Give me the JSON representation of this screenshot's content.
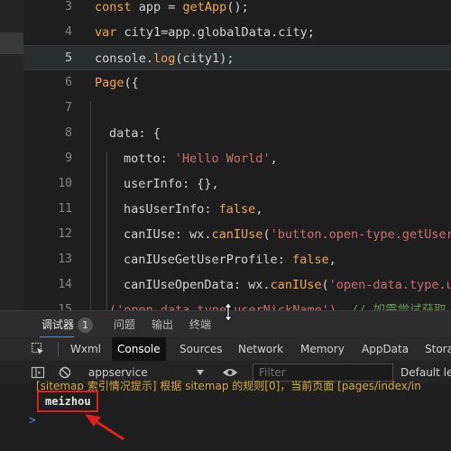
{
  "editor": {
    "lines": [
      {
        "num": "3",
        "tokens": [
          {
            "c": "kw",
            "t": "const"
          },
          {
            "c": "plain",
            "t": " app = "
          },
          {
            "c": "fn",
            "t": "getApp"
          },
          {
            "c": "plain",
            "t": "();"
          }
        ]
      },
      {
        "num": "4",
        "tokens": [
          {
            "c": "kw",
            "t": "var"
          },
          {
            "c": "plain",
            "t": " city1=app.globalData.city;"
          }
        ]
      },
      {
        "num": "5",
        "tokens": [
          {
            "c": "plain",
            "t": "console."
          },
          {
            "c": "fn",
            "t": "log"
          },
          {
            "c": "plain",
            "t": "(city1);"
          }
        ]
      },
      {
        "num": "6",
        "tokens": [
          {
            "c": "fn",
            "t": "Page"
          },
          {
            "c": "plain",
            "t": "({"
          }
        ]
      },
      {
        "num": "7",
        "tokens": []
      },
      {
        "num": "8",
        "tokens": [
          {
            "c": "prop",
            "t": "data"
          },
          {
            "c": "plain",
            "t": ": {"
          }
        ]
      },
      {
        "num": "9",
        "tokens": [
          {
            "c": "prop",
            "t": "motto"
          },
          {
            "c": "plain",
            "t": ": "
          },
          {
            "c": "str",
            "t": "'Hello World'"
          },
          {
            "c": "plain",
            "t": ","
          }
        ]
      },
      {
        "num": "10",
        "tokens": [
          {
            "c": "prop",
            "t": "userInfo"
          },
          {
            "c": "plain",
            "t": ": {},"
          }
        ]
      },
      {
        "num": "11",
        "tokens": [
          {
            "c": "prop",
            "t": "hasUserInfo"
          },
          {
            "c": "plain",
            "t": ": "
          },
          {
            "c": "lit",
            "t": "false"
          },
          {
            "c": "plain",
            "t": ","
          }
        ]
      },
      {
        "num": "12",
        "tokens": [
          {
            "c": "prop",
            "t": "canIUse"
          },
          {
            "c": "plain",
            "t": ": wx."
          },
          {
            "c": "fn",
            "t": "canIUse"
          },
          {
            "c": "plain",
            "t": "("
          },
          {
            "c": "str",
            "t": "'button.open-type.getUserI"
          }
        ]
      },
      {
        "num": "13",
        "tokens": [
          {
            "c": "prop",
            "t": "canIUseGetUserProfile"
          },
          {
            "c": "plain",
            "t": ": "
          },
          {
            "c": "lit",
            "t": "false"
          },
          {
            "c": "plain",
            "t": ","
          }
        ]
      },
      {
        "num": "14",
        "tokens": [
          {
            "c": "prop",
            "t": "canIUseOpenData"
          },
          {
            "c": "plain",
            "t": ": wx."
          },
          {
            "c": "fn",
            "t": "canIUse"
          },
          {
            "c": "plain",
            "t": "("
          },
          {
            "c": "str",
            "t": "'open-data.type.us"
          }
        ]
      },
      {
        "num": "15",
        "tokens": [
          {
            "c": "str",
            "t": "('open-data.type.userNickName')"
          },
          {
            "c": "plain",
            "t": "  "
          },
          {
            "c": "cmt",
            "t": "// 如需尝试获取"
          }
        ]
      }
    ]
  },
  "debugger_tabs": {
    "debugger": "调试器",
    "badge": "1",
    "problems": "问题",
    "output": "输出",
    "terminal": "终端"
  },
  "devtools_tabs": [
    "Wxml",
    "Console",
    "Sources",
    "Network",
    "Memory",
    "AppData",
    "Storag"
  ],
  "console_toolbar": {
    "context": "appservice",
    "filter_placeholder": "Filter",
    "levels": "Default lev"
  },
  "console": {
    "warning_text": "[sitemap 索引情况提示] 根据 sitemap 的规则[0]，当前页面 [pages/index/in",
    "log_output": "meizhou",
    "prompt": ">"
  },
  "colors": {
    "highlight_box": "#e02020",
    "arrow": "#e02020",
    "accent": "#4d8fd6"
  }
}
